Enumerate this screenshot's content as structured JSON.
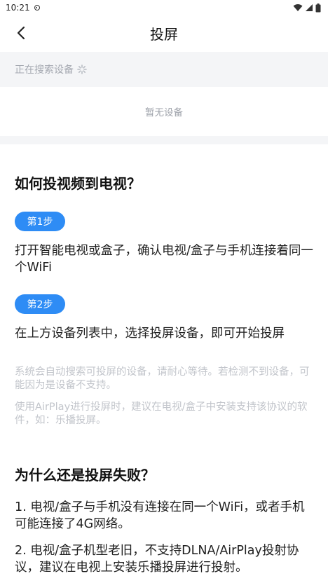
{
  "status_bar": {
    "time": "10:21",
    "icons": [
      "notification-icon",
      "wifi-icon",
      "signal-icon",
      "battery-icon"
    ]
  },
  "header": {
    "title": "投屏",
    "back_icon": "chevron-left-icon"
  },
  "search": {
    "status": "正在搜索设备",
    "spinner_icon": "loading-spinner-icon"
  },
  "device_list": {
    "empty_text": "暂无设备"
  },
  "how_to": {
    "heading": "如何投视频到电视？",
    "steps": [
      {
        "badge": "第1步",
        "text": "打开智能电视或盒子，确认电视/盒子与手机连接着同一个WiFi"
      },
      {
        "badge": "第2步",
        "text": "在上方设备列表中，选择投屏设备，即可开始投屏"
      }
    ],
    "notes": [
      "系统会自动搜索可投屏的设备，请耐心等待。若检测不到设备，可能因为是设备不支持。",
      "使用AirPlay进行投屏时，建议在电视/盒子中安装支持该协议的软件，如：乐播投屏。"
    ]
  },
  "why_failed": {
    "heading": "为什么还是投屏失败？",
    "items": [
      "1. 电视/盒子与手机没有连接在同一个WiFi，或者手机可能连接了4G网络。",
      "2. 电视/盒子机型老旧，不支持DLNA/AirPlay投射协议，建议在电视上安装乐播投屏进行投射。"
    ]
  },
  "colors": {
    "accent": "#2e8cf5",
    "page_bg": "#ffffff",
    "section_bg": "#f4f5f7",
    "muted_text": "#c2c5cb"
  }
}
